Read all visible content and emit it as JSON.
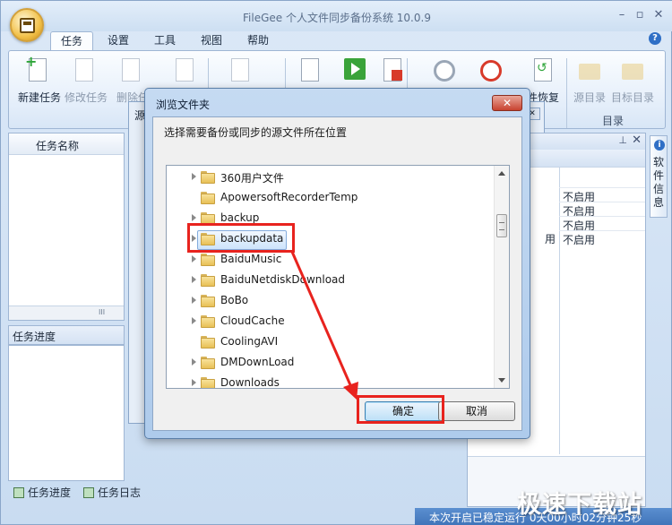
{
  "window": {
    "title": "FileGee 个人文件同步备份系统 10.0.9",
    "min_glyph": "–",
    "max_glyph": "▫",
    "close_glyph": "✕"
  },
  "menu": {
    "tabs": [
      "任务",
      "设置",
      "工具",
      "视图",
      "帮助"
    ],
    "active_index": 0
  },
  "ribbon": {
    "buttons": [
      "新建任务",
      "修改任务",
      "删除任"
    ],
    "restore_label": "件恢复",
    "dir_group": {
      "buttons": [
        "源目录",
        "目标目录"
      ],
      "group_label": "目录"
    }
  },
  "task_list": {
    "column_header": "任务名称",
    "scroll_grip": "III"
  },
  "progress_panel": {
    "title": "任务进度"
  },
  "bottom_tabs": [
    "任务进度",
    "任务日志"
  ],
  "under_dialog": {
    "title_fragment": "源",
    "close_glyph": "✕"
  },
  "right_panel": {
    "pin": "⊥",
    "close": "✕",
    "rows": [
      "不启用",
      "不启用",
      "不启用",
      "不启用"
    ],
    "row_fragment": "用"
  },
  "side_tab": {
    "icon": "i",
    "label": "软件信息"
  },
  "status": {
    "text": "本次开启已稳定运行 0天00小时02分钟25秒"
  },
  "watermark": "极速下载站",
  "browse_dialog": {
    "title": "浏览文件夹",
    "close_glyph": "✕",
    "description": "选择需要备份或同步的源文件所在位置",
    "folders": [
      {
        "name": "360用户文件",
        "expandable": true,
        "selected": false
      },
      {
        "name": "ApowersoftRecorderTemp",
        "expandable": false,
        "selected": false
      },
      {
        "name": "backup",
        "expandable": true,
        "selected": false
      },
      {
        "name": "backupdata",
        "expandable": true,
        "selected": true
      },
      {
        "name": "BaiduMusic",
        "expandable": true,
        "selected": false
      },
      {
        "name": "BaiduNetdiskDownload",
        "expandable": true,
        "selected": false
      },
      {
        "name": "BoBo",
        "expandable": true,
        "selected": false
      },
      {
        "name": "CloudCache",
        "expandable": true,
        "selected": false
      },
      {
        "name": "CoolingAVI",
        "expandable": false,
        "selected": false
      },
      {
        "name": "DMDownLoad",
        "expandable": true,
        "selected": false
      },
      {
        "name": "Downloads",
        "expandable": true,
        "selected": false
      }
    ],
    "ok_label": "确定",
    "cancel_label": "取消"
  },
  "help_glyph": "?",
  "colors": {
    "highlight": "#e8231e",
    "accent": "#2f6fc6",
    "status_bar": "#4a7fc2"
  }
}
